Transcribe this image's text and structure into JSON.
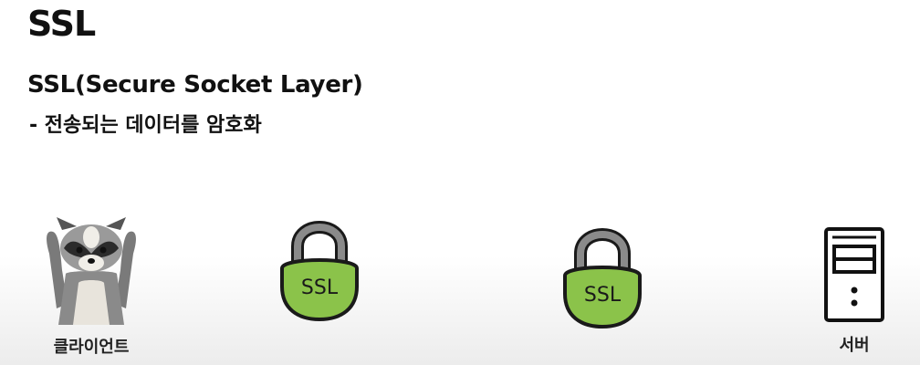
{
  "slide": {
    "title": "SSL",
    "subtitle": "SSL(Secure Socket Layer)",
    "bullet": "- 전송되는 데이터를 암호화"
  },
  "client": {
    "label": "클라이언트",
    "icon": "raccoon-image"
  },
  "locks": [
    {
      "text": "SSL",
      "icon": "padlock-icon",
      "color": "#8bc34a"
    },
    {
      "text": "SSL",
      "icon": "padlock-icon",
      "color": "#8bc34a"
    }
  ],
  "server": {
    "label": "서버",
    "icon": "server-icon"
  }
}
